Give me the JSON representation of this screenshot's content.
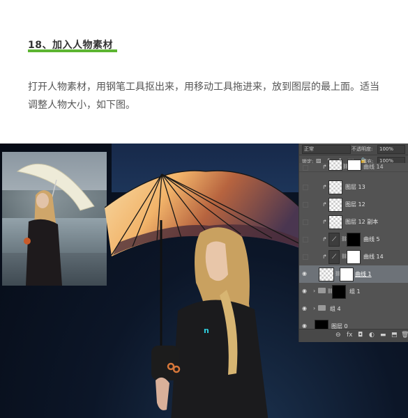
{
  "article": {
    "step_title": "18、加入人物素材",
    "description": "打开人物素材，用钢笔工具抠出来，用移动工具拖进来，放到图层的最上面。适当调整人物大小，如下图。"
  },
  "canvas": {
    "group_label": "",
    "cursor_glyph": "n"
  },
  "layers_panel": {
    "blend_mode": "正常",
    "opacity_label": "不透明度:",
    "opacity_value": "100%",
    "lock_label": "锁定:",
    "lock_icons": "▨ ✎ ✥ ⬚ 🔒",
    "fill_label": "填充:",
    "fill_value": "100%",
    "layers": [
      {
        "name": "曲线 14",
        "visible": false,
        "clipped": true
      },
      {
        "name": "图层 13",
        "visible": false,
        "clipped": true
      },
      {
        "name": "图层 12",
        "visible": false,
        "clipped": true
      },
      {
        "name": "图层 12 副本",
        "visible": false,
        "clipped": true
      },
      {
        "name": "曲线 5",
        "visible": false,
        "clipped": true
      },
      {
        "name": "曲线 14",
        "visible": false,
        "clipped": true
      },
      {
        "name": "曲线 1",
        "visible": true,
        "selected": true
      },
      {
        "name": "组 1",
        "visible": true
      },
      {
        "name": "组 4",
        "visible": true
      },
      {
        "name": "图层 0",
        "visible": true
      }
    ],
    "footer_icons": [
      "link-icon",
      "fx-icon",
      "mask-icon",
      "adjustment-icon",
      "folder-icon",
      "new-layer-icon",
      "trash-icon"
    ],
    "footer_glyphs": [
      "⊖",
      "fx",
      "◘",
      "◐",
      "▬",
      "⬒",
      "🗑"
    ]
  }
}
